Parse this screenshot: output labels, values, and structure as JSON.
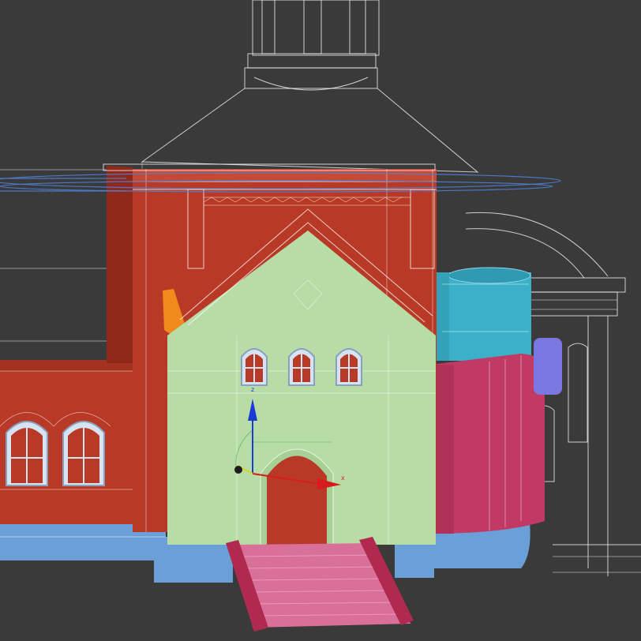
{
  "viewport": {
    "background": "#3a3a3a"
  },
  "colors": {
    "wireframe": "#ffffff",
    "selection_wire": "#4f7fd6",
    "red_wall": "#b83a26",
    "green_facade": "#b7dca6",
    "blue_base": "#6a9fd8",
    "cyan_tower": "#3bb0c8",
    "magenta_block": "#c03a63",
    "pink_stairs": "#d9709a",
    "stair_rail": "#b02a4f",
    "orange_piece": "#f08a1c",
    "violet_piece": "#7a78e0",
    "gizmo_z": "#1b3bd8",
    "gizmo_x": "#d81b1b",
    "gizmo_y": "#d8d81b"
  },
  "gizmo": {
    "z_label": "z",
    "x_label": "x"
  }
}
